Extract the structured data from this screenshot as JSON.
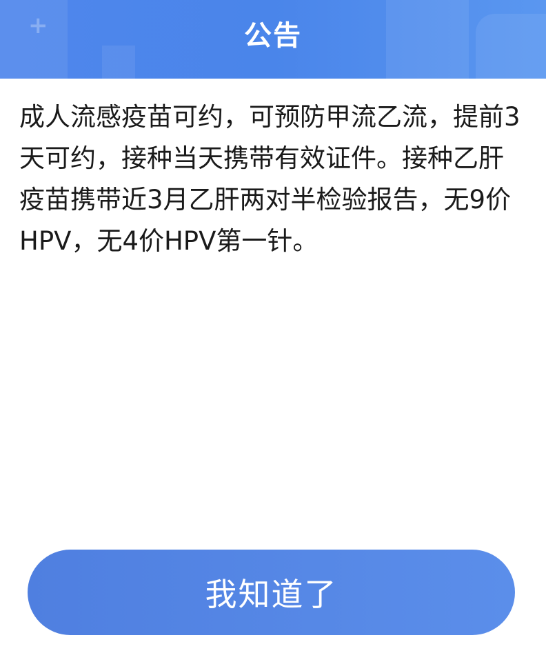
{
  "dialog": {
    "title": "公告",
    "message": "成人流感疫苗可约，可预防甲流乙流，提前3天可约，接种当天携带有效证件。接种乙肝疫苗携带近3月乙肝两对半检验报告，无9价HPV，无4价HPV第一针。",
    "confirm_label": "我知道了"
  },
  "colors": {
    "header": "#4a85ea",
    "button": "#5a8ae8",
    "text": "#1a1a1a"
  },
  "icons": {
    "header_decoration": "plus-icon"
  }
}
